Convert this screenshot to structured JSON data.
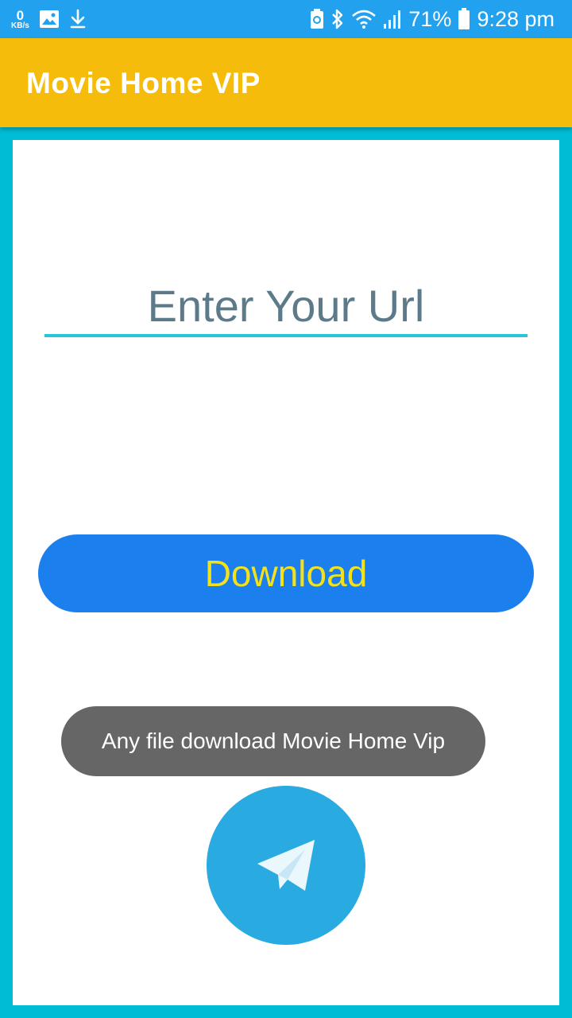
{
  "status_bar": {
    "net_speed_value": "0",
    "net_speed_unit": "KB/s",
    "battery_percent": "71%",
    "time": "9:28 pm",
    "icons": [
      "image-icon",
      "download-icon",
      "battery-saver-icon",
      "bluetooth-icon",
      "wifi-icon",
      "signal-icon",
      "battery-icon"
    ]
  },
  "app_bar": {
    "title": "Movie Home VIP",
    "color": "#f5bc0c"
  },
  "form": {
    "url_placeholder": "Enter Your Url",
    "download_label": "Download",
    "button_color": "#1b80ee",
    "button_text_color": "#f4e11a"
  },
  "fab": {
    "icon": "telegram-icon",
    "color": "#29abe2"
  },
  "toast": {
    "message": "Any file download Movie Home Vip"
  },
  "colors": {
    "frame": "#00bcd4",
    "status_bar": "#21a1ee"
  }
}
